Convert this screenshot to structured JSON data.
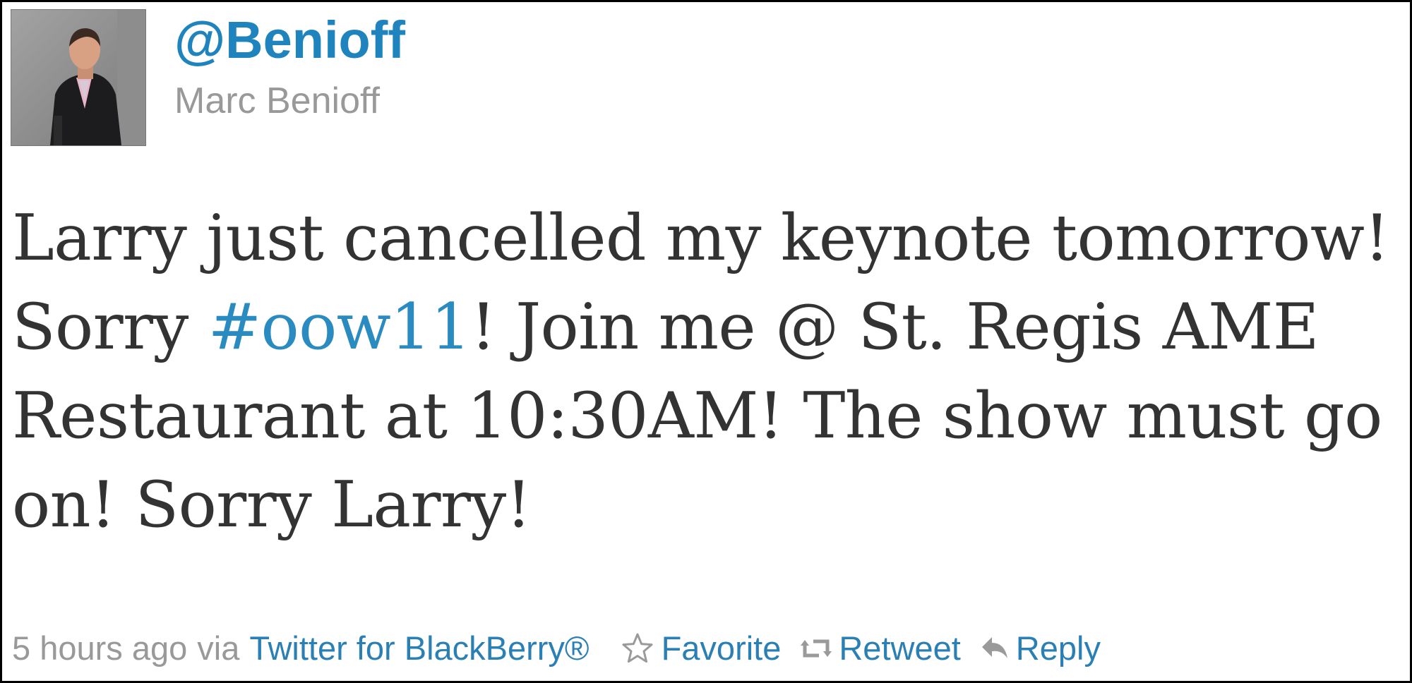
{
  "user": {
    "handle": "@Benioff",
    "name": "Marc Benioff",
    "avatar_icon": "profile-photo"
  },
  "tweet": {
    "text_before": "Larry just cancelled my keynote tomorrow! Sorry ",
    "hashtag": "#oow11",
    "text_after": "! Join me @ St. Regis AME Restaurant at 10:30AM! The show must go on! Sorry Larry!"
  },
  "meta": {
    "time": "5 hours ago",
    "via_label": "via",
    "source": "Twitter for BlackBerry®"
  },
  "actions": {
    "favorite_label": "Favorite",
    "favorite_icon": "star-icon",
    "retweet_label": "Retweet",
    "retweet_icon": "retweet-icon",
    "reply_label": "Reply",
    "reply_icon": "reply-arrow-icon"
  },
  "colors": {
    "link": "#1f84bd",
    "text": "#333333",
    "muted": "#999999"
  }
}
